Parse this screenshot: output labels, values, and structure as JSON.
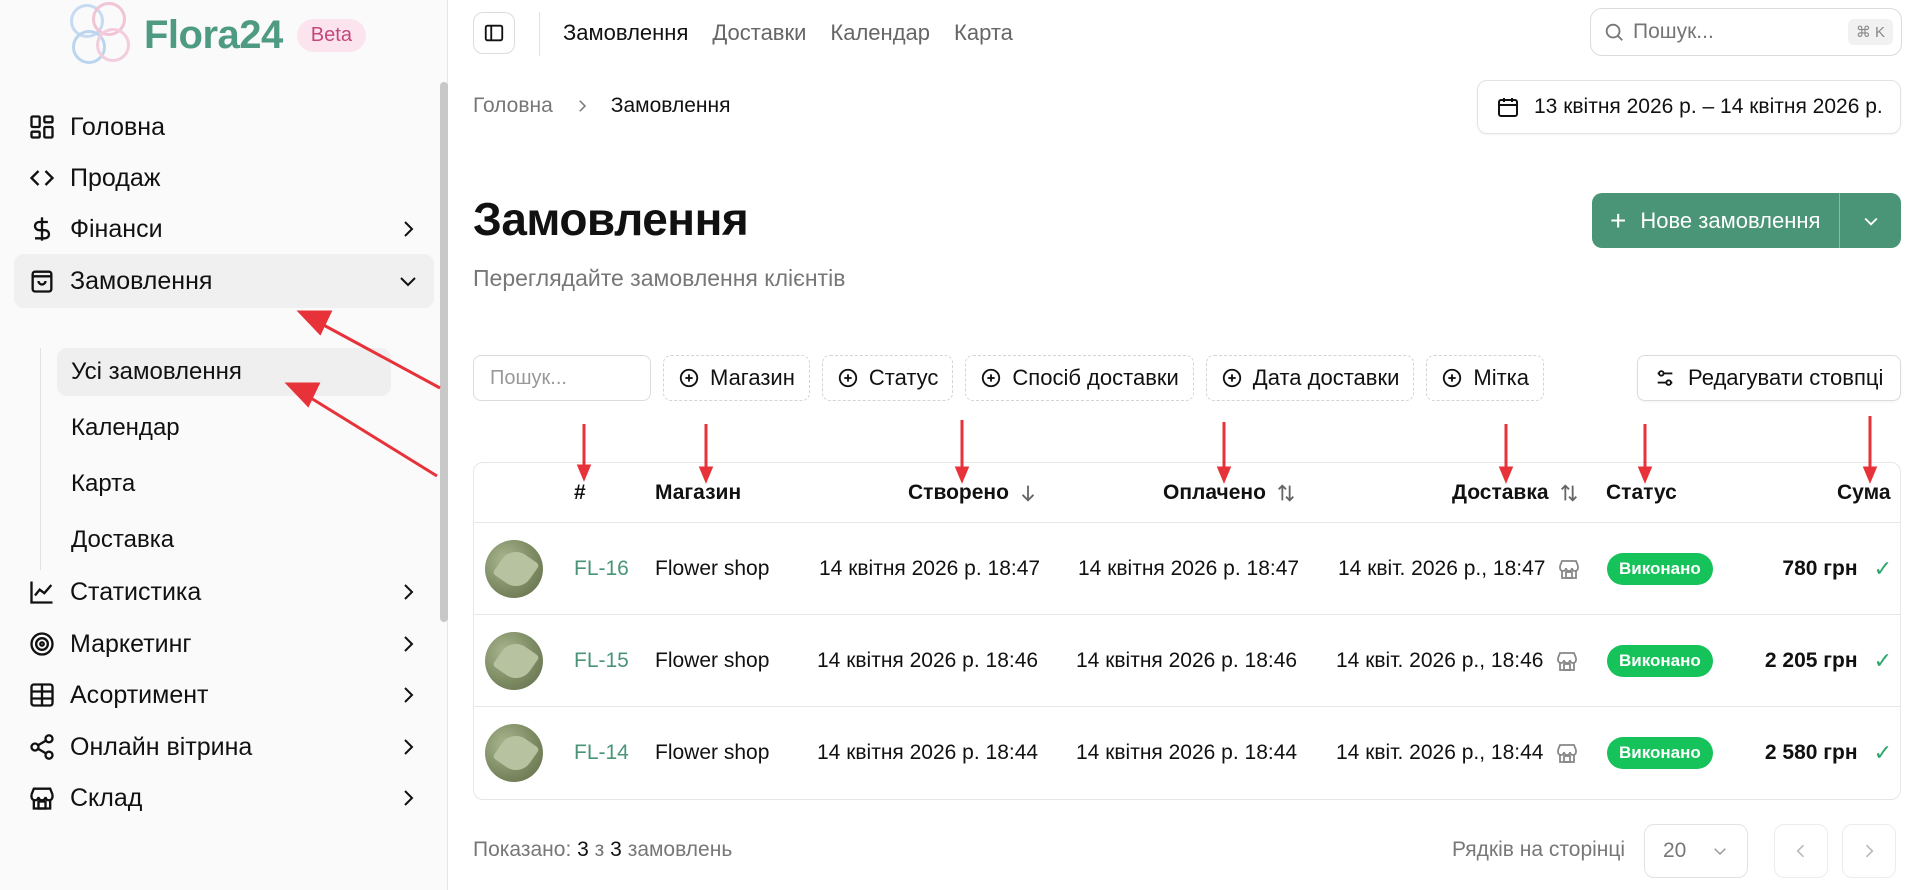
{
  "app": {
    "name": "Flora24",
    "badge": "Beta"
  },
  "sidebar": {
    "items": [
      {
        "label": "Головна",
        "icon": "dashboard-icon"
      },
      {
        "label": "Продаж",
        "icon": "code-icon"
      },
      {
        "label": "Фінанси",
        "icon": "dollar-icon"
      },
      {
        "label": "Замовлення",
        "icon": "shopping-bag-icon"
      },
      {
        "label": "Статистика",
        "icon": "line-chart-icon"
      },
      {
        "label": "Маркетинг",
        "icon": "target-icon"
      },
      {
        "label": "Асортимент",
        "icon": "grid-icon"
      },
      {
        "label": "Онлайн вітрина",
        "icon": "share-icon"
      },
      {
        "label": "Склад",
        "icon": "store-icon"
      }
    ],
    "orders_sub": [
      "Усі замовлення",
      "Календар",
      "Карта",
      "Доставка"
    ]
  },
  "topbar": {
    "tabs": [
      "Замовлення",
      "Доставки",
      "Календар",
      "Карта"
    ],
    "search_placeholder": "Пошук...",
    "shortcut": "⌘ K"
  },
  "breadcrumb": {
    "home": "Головна",
    "current": "Замовлення"
  },
  "date_range": "13 квітня 2026 р. – 14 квітня 2026 р.",
  "page": {
    "title": "Замовлення",
    "subtitle": "Переглядайте замовлення клієнтів",
    "new_button": "Нове замовлення"
  },
  "filters": {
    "search_placeholder": "Пошук...",
    "chips": [
      "Магазин",
      "Статус",
      "Спосіб доставки",
      "Дата доставки",
      "Мітка"
    ],
    "edit_columns": "Редагувати стовпці"
  },
  "table": {
    "headers": {
      "id": "#",
      "shop": "Магазин",
      "created": "Створено",
      "paid": "Оплачено",
      "delivery": "Доставка",
      "status": "Статус",
      "sum": "Сума"
    },
    "rows": [
      {
        "id": "FL-16",
        "shop": "Flower shop",
        "created": "14 квітня 2026 р. 18:47",
        "paid": "14 квітня 2026 р. 18:47",
        "delivery": "14 квіт. 2026 р., 18:47",
        "status": "Виконано",
        "sum": "780 грн"
      },
      {
        "id": "FL-15",
        "shop": "Flower shop",
        "created": "14 квітня 2026 р. 18:46",
        "paid": "14 квітня 2026 р. 18:46",
        "delivery": "14 квіт. 2026 р., 18:46",
        "status": "Виконано",
        "sum": "2 205 грн"
      },
      {
        "id": "FL-14",
        "shop": "Flower shop",
        "created": "14 квітня 2026 р. 18:44",
        "paid": "14 квітня 2026 р. 18:44",
        "delivery": "14 квіт. 2026 р., 18:44",
        "status": "Виконано",
        "sum": "2 580 грн"
      }
    ]
  },
  "footer": {
    "shown_prefix": "Показано:",
    "shown": "3",
    "of": "з",
    "total": "3",
    "suffix": "замовлень",
    "rows_per_page_label": "Рядків на сторінці",
    "rows_per_page": "20"
  },
  "colors": {
    "brand": "#4a9478",
    "status_done": "#16c25a",
    "annotation_arrow": "#e8323a"
  }
}
